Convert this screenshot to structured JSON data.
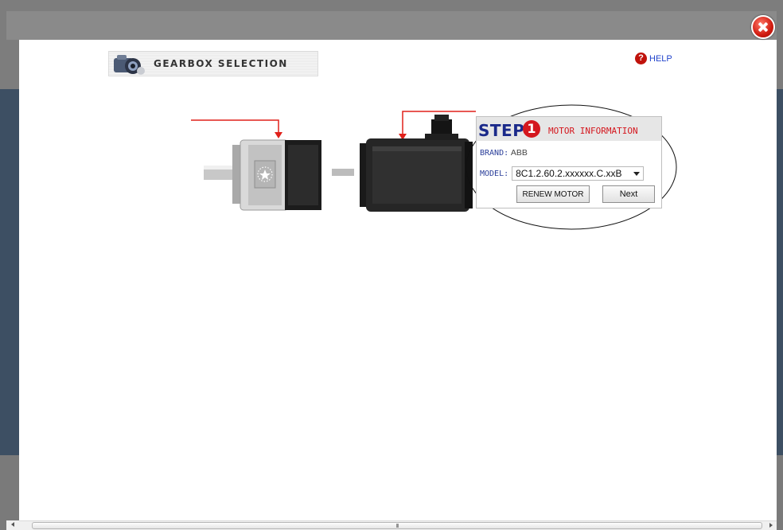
{
  "modal": {
    "close_icon": "close-icon",
    "header": {
      "icon": "camera-gear-icon",
      "title": "GEARBOX SELECTION"
    },
    "help": {
      "icon": "question-icon",
      "label": "HELP"
    }
  },
  "illustration": {
    "gearbox": "gearbox-image",
    "motor": "motor-image",
    "arrow_color": "#e0201a"
  },
  "step_panel": {
    "step_word": "STEP",
    "step_number": "1",
    "title": "MOTOR INFORMATION",
    "brand_label": "BRAND:",
    "brand_value": "ABB",
    "model_label": "MODEL:",
    "model_value": "8C1.2.60.2.xxxxxx.C.xxB",
    "renew_button": "RENEW MOTOR",
    "next_button": "Next"
  },
  "scrollbar": {
    "grip": "III"
  },
  "colors": {
    "accent_red": "#d4171e",
    "step_blue": "#1b2a8a",
    "label_blue": "#2b3f9a"
  }
}
